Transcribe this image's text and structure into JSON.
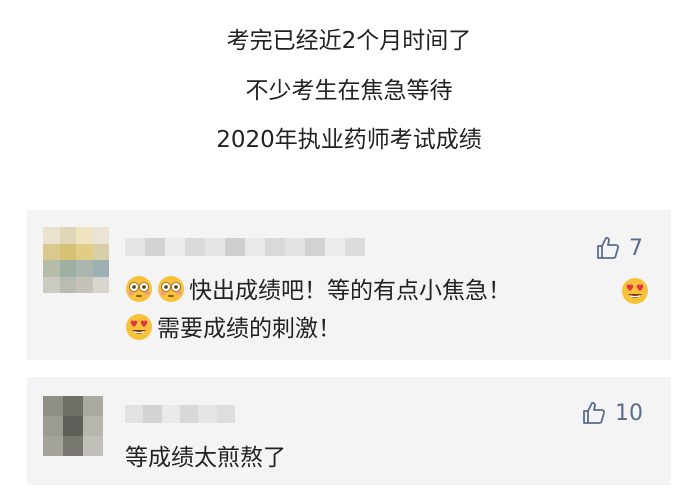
{
  "intro": {
    "line1": "考完已经近2个月时间了",
    "line2": "不少考生在焦急等待",
    "line3": "2020年执业药师考试成绩"
  },
  "comments": [
    {
      "likes": "7",
      "text_part1": "快出成绩吧！等的有点小焦急！",
      "text_part2": "需要成绩的刺激！",
      "emojis": [
        "flushed-face",
        "flushed-face",
        "heart-eyes-face",
        "heart-eyes-face"
      ]
    },
    {
      "likes": "10",
      "text": "等成绩太煎熬了"
    }
  ],
  "colors": {
    "card_bg": "#f4f4f4",
    "like_blue": "#5a6c8c",
    "text": "#222222"
  }
}
